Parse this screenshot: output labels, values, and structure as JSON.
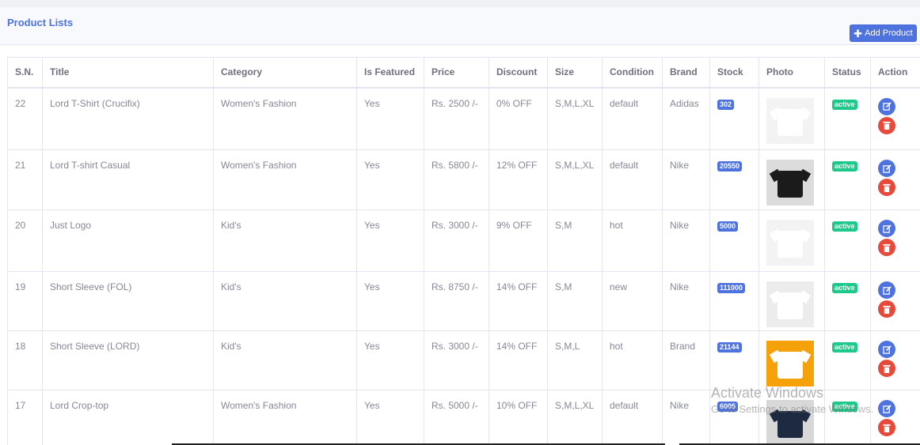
{
  "header": {
    "title": "Product Lists",
    "add_label": "Add Product",
    "add_icon": "plus-icon"
  },
  "columns": [
    "S.N.",
    "Title",
    "Category",
    "Is Featured",
    "Price",
    "Discount",
    "Size",
    "Condition",
    "Brand",
    "Stock",
    "Photo",
    "Status",
    "Action"
  ],
  "rows": [
    {
      "sn": "22",
      "title": "Lord T-Shirt (Crucifix)",
      "category": "Women's Fashion",
      "featured": "Yes",
      "price": "Rs. 2500 /-",
      "discount": "0% OFF",
      "size": "S,M,L,XL",
      "condition": "default",
      "brand": "Adidas",
      "stock": "302",
      "status": "active",
      "photo": "white-tshirt"
    },
    {
      "sn": "21",
      "title": "Lord T-shirt Casual",
      "category": "Women's Fashion",
      "featured": "Yes",
      "price": "Rs. 5800 /-",
      "discount": "12% OFF",
      "size": "S,M,L,XL",
      "condition": "default",
      "brand": "Nike",
      "stock": "20550",
      "status": "active",
      "photo": "black-tshirt"
    },
    {
      "sn": "20",
      "title": "Just Logo",
      "category": "Kid's",
      "featured": "Yes",
      "price": "Rs. 3000 /-",
      "discount": "9% OFF",
      "size": "S,M",
      "condition": "hot",
      "brand": "Nike",
      "stock": "5000",
      "status": "active",
      "photo": "white-tshirt"
    },
    {
      "sn": "19",
      "title": "Short Sleeve (FOL)",
      "category": "Kid's",
      "featured": "Yes",
      "price": "Rs. 8750 /-",
      "discount": "14% OFF",
      "size": "S,M",
      "condition": "new",
      "brand": "Nike",
      "stock": "111000",
      "status": "active",
      "photo": "white-tshirt-pair"
    },
    {
      "sn": "18",
      "title": "Short Sleeve (LORD)",
      "category": "Kid's",
      "featured": "Yes",
      "price": "Rs. 3000 /-",
      "discount": "14% OFF",
      "size": "S,M,L",
      "condition": "hot",
      "brand": "Brand",
      "stock": "21144",
      "status": "active",
      "photo": "orange-pair"
    },
    {
      "sn": "17",
      "title": "Lord Crop-top",
      "category": "Women's Fashion",
      "featured": "Yes",
      "price": "Rs. 5000 /-",
      "discount": "10% OFF",
      "size": "S,M,L,XL",
      "condition": "default",
      "brand": "Nike",
      "stock": "6005",
      "status": "active",
      "photo": "navy-crop"
    }
  ],
  "actions": {
    "edit_icon": "edit-icon",
    "delete_icon": "trash-icon"
  },
  "watermark": {
    "line1": "Activate Windows",
    "line2": "Go to Settings to activate Windows."
  },
  "colors": {
    "primary": "#4e73df",
    "success": "#1cc88a",
    "danger": "#e74a3b"
  }
}
